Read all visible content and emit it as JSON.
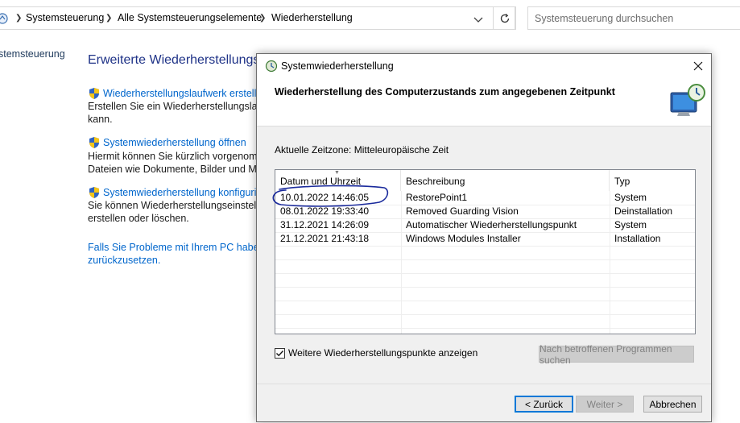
{
  "addressbar": {
    "crumbs": [
      "Systemsteuerung",
      "Alle Systemsteuerungselemente",
      "Wiederherstellung"
    ],
    "search_placeholder": "Systemsteuerung durchsuchen"
  },
  "left_nav": {
    "item": "stemsteuerung"
  },
  "background": {
    "title": "Erweiterte Wiederherstellungs",
    "links": [
      {
        "label": "Wiederherstellungslaufwerk erstellen",
        "lines": [
          "Erstellen Sie ein Wiederherstellungslaufw",
          "kann."
        ]
      },
      {
        "label": "Systemwiederherstellung öffnen",
        "lines": [
          "Hiermit können Sie kürzlich vorgenomm",
          "Dateien wie Dokumente, Bilder und Mus"
        ]
      },
      {
        "label": "Systemwiederherstellung konfigurier",
        "lines": [
          "Sie können Wiederherstellungseinstellun",
          "erstellen oder löschen."
        ]
      }
    ],
    "problem_text": [
      "Falls Sie Probleme mit Ihrem PC haben,",
      "zurückzusetzen."
    ]
  },
  "dialog": {
    "title": "Systemwiederherstellung",
    "header": "Wiederherstellung des Computerzustands zum angegebenen Zeitpunkt",
    "timezone": "Aktuelle Zeitzone: Mitteleuropäische Zeit",
    "columns": [
      "Datum und Uhrzeit",
      "Beschreibung",
      "Typ"
    ],
    "rows": [
      {
        "date": "10.01.2022 14:46:05",
        "description": "RestorePoint1",
        "type": "System"
      },
      {
        "date": "08.01.2022 19:33:40",
        "description": "Removed Guarding Vision",
        "type": "Deinstallation"
      },
      {
        "date": "31.12.2021 14:26:09",
        "description": "Automatischer Wiederherstellungspunkt",
        "type": "System"
      },
      {
        "date": "21.12.2021 21:43:18",
        "description": "Windows Modules Installer",
        "type": "Installation"
      }
    ],
    "checkbox_label": "Weitere Wiederherstellungspunkte anzeigen",
    "checkbox_checked": true,
    "scan_button": "Nach betroffenen Programmen suchen",
    "back_button": "< Zurück",
    "next_button": "Weiter >",
    "cancel_button": "Abbrechen"
  },
  "colors": {
    "link": "#0066cc",
    "title_blue": "#1e3287",
    "annotation": "#1a2a9c",
    "default_button_border": "#0078d7"
  }
}
